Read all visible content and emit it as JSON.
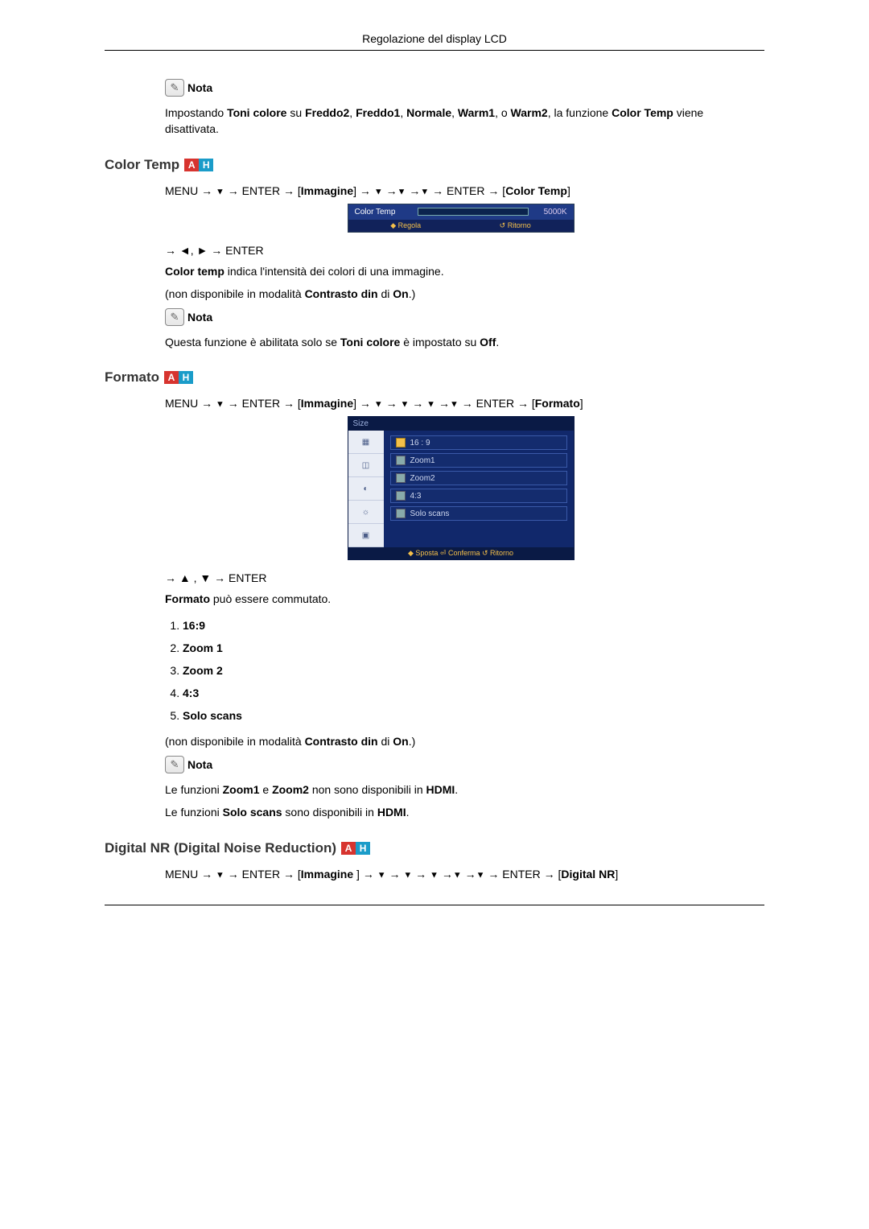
{
  "header": {
    "title": "Regolazione del display LCD"
  },
  "note": {
    "label": "Nota"
  },
  "intro_note": {
    "pre": "Impostando ",
    "b1": "Toni colore",
    "mid1": " su ",
    "b2": "Freddo2",
    "c1": ", ",
    "b3": "Freddo1",
    "c2": ", ",
    "b4": "Normale",
    "c3": ", ",
    "b5": "Warm1",
    "c4": ", o ",
    "b6": "Warm2",
    "mid2": ", la funzione ",
    "b7": "Color Temp",
    "post": " viene disattivata."
  },
  "section_color_temp": {
    "title": "Color Temp",
    "path_pre": "MENU → ",
    "path_enter": " → ENTER → [",
    "path_img": "Immagine",
    "path_mid": "] → ",
    "path_after": " → ENTER → [",
    "path_target": "Color Temp",
    "path_close": "]",
    "osd": {
      "label": "Color Temp",
      "value": "5000K",
      "regola": "Regola",
      "ritorno": "Ritorno"
    },
    "nav2": "→ ◄, ► → ENTER",
    "desc_pre": "Color temp",
    "desc_post": " indica l'intensità dei colori di una immagine.",
    "restrict_pre": "(non disponibile in modalità ",
    "restrict_b1": "Contrasto din",
    "restrict_mid": " di ",
    "restrict_b2": "On",
    "restrict_post": ".)",
    "enabled_pre": "Questa funzione è abilitata solo se ",
    "enabled_b1": "Toni colore",
    "enabled_mid": " è impostato su ",
    "enabled_b2": "Off",
    "enabled_post": "."
  },
  "section_formato": {
    "title": "Formato",
    "path_pre": "MENU → ",
    "path_enter": " → ENTER → [",
    "path_img": "Immagine",
    "path_mid": "] → ",
    "path_after": " → ENTER → [",
    "path_target": "Formato",
    "path_close": "]",
    "osd": {
      "title": "Size",
      "opts": [
        "16 : 9",
        "Zoom1",
        "Zoom2",
        "4:3",
        "Solo scans"
      ],
      "foot": "◆ Sposta   ⏎ Conferma ↺  Ritorno"
    },
    "nav2": "→ ▲ , ▼ → ENTER",
    "switch_pre": "Formato",
    "switch_post": " può essere commutato.",
    "list": [
      "16:9",
      "Zoom 1",
      "Zoom 2",
      "4:3",
      "Solo scans"
    ],
    "restrict_pre": "(non disponibile in modalità ",
    "restrict_b1": "Contrasto din",
    "restrict_mid": " di ",
    "restrict_b2": "On",
    "restrict_post": ".)",
    "note1_pre": "Le funzioni ",
    "note1_b1": "Zoom1",
    "note1_mid1": " e ",
    "note1_b2": "Zoom2",
    "note1_mid2": " non sono disponibili in ",
    "note1_b3": "HDMI",
    "note1_post": ".",
    "note2_pre": "Le funzioni ",
    "note2_b1": "Solo scans",
    "note2_mid": " sono disponibili in ",
    "note2_b2": "HDMI",
    "note2_post": "."
  },
  "section_dnr": {
    "title": "Digital NR (Digital Noise Reduction)",
    "path_pre": "MENU → ",
    "path_enter": " → ENTER → [",
    "path_img": "Immagine ",
    "path_mid": "] → ",
    "path_after": " → ENTER → [",
    "path_target": "Digital NR",
    "path_close": "]"
  },
  "glyph_down": "▼"
}
